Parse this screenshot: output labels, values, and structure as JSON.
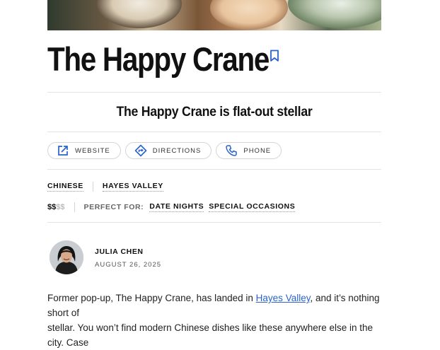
{
  "restaurant": {
    "name": "The Happy Crane",
    "tagline": "The Happy Crane is flat-out stellar"
  },
  "actions": [
    {
      "label": "WEBSITE",
      "icon": "external-link-icon"
    },
    {
      "label": "DIRECTIONS",
      "icon": "directions-icon"
    },
    {
      "label": "PHONE",
      "icon": "phone-icon"
    }
  ],
  "tags": {
    "cuisine": "CHINESE",
    "neighborhood": "HAYES VALLEY"
  },
  "price": {
    "active": "$$",
    "inactive": "$$"
  },
  "perfect_for": {
    "label": "PERFECT FOR:",
    "items": [
      "DATE NIGHTS",
      "SPECIAL OCCASIONS"
    ]
  },
  "author": {
    "name": "JULIA CHEN",
    "date": "AUGUST 26, 2025"
  },
  "body": {
    "line1_before": "Former pop-up, The Happy Crane, has landed in ",
    "link": "Hayes Valley",
    "line1_after": ", and it’s nothing short of",
    "line2": "stellar. You won’t find modern Chinese dishes like these anywhere else in the city. Case"
  },
  "colors": {
    "accent": "#2a63c9",
    "text": "#111111",
    "divider": "#e3e3e3"
  }
}
